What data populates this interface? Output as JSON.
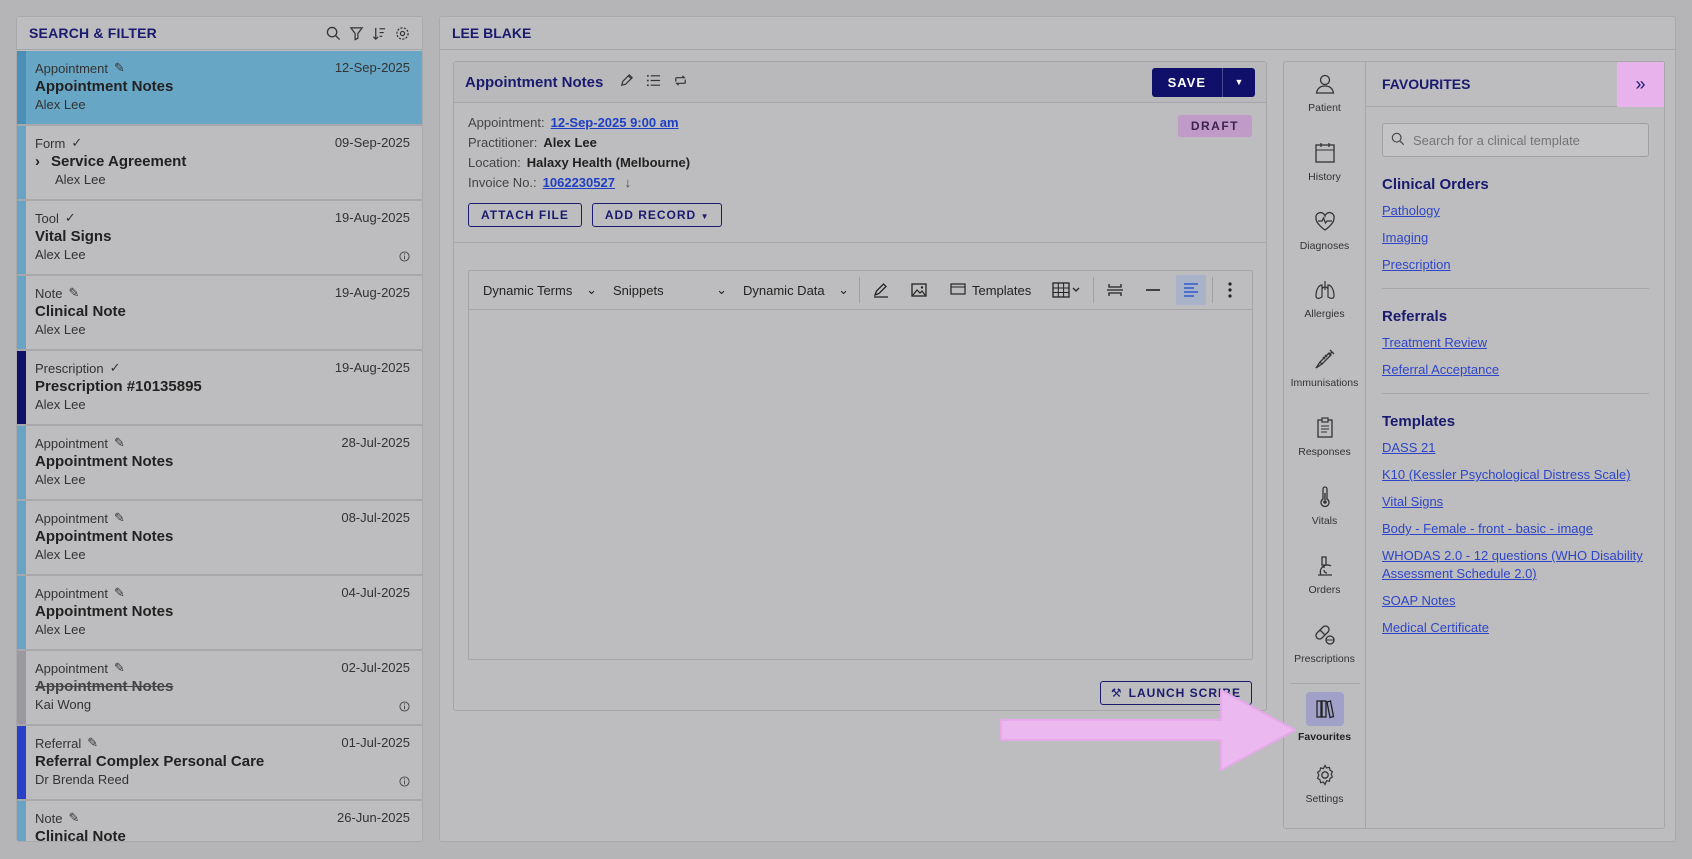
{
  "left_panel": {
    "title": "SEARCH & FILTER",
    "items": [
      {
        "type": "Appointment",
        "date": "12-Sep-2025",
        "title": "Appointment Notes",
        "who": "Alex Lee",
        "bar": "#6aa4c4"
      },
      {
        "type": "Form",
        "date": "09-Sep-2025",
        "title": "Service Agreement",
        "who": "Alex Lee",
        "bar": "#6aa4c4"
      },
      {
        "type": "Tool",
        "date": "19-Aug-2025",
        "title": "Vital Signs",
        "who": "Alex Lee",
        "bar": "#6aa4c4"
      },
      {
        "type": "Note",
        "date": "19-Aug-2025",
        "title": "Clinical Note",
        "who": "Alex Lee",
        "bar": "#6aa4c4"
      },
      {
        "type": "Prescription",
        "date": "19-Aug-2025",
        "title": "Prescription #10135895",
        "who": "Alex Lee",
        "bar": "#10106a"
      },
      {
        "type": "Appointment",
        "date": "28-Jul-2025",
        "title": "Appointment Notes",
        "who": "Alex Lee",
        "bar": "#6aa4c4"
      },
      {
        "type": "Appointment",
        "date": "08-Jul-2025",
        "title": "Appointment Notes",
        "who": "Alex Lee",
        "bar": "#6aa4c4"
      },
      {
        "type": "Appointment",
        "date": "04-Jul-2025",
        "title": "Appointment Notes",
        "who": "Alex Lee",
        "bar": "#6aa4c4"
      },
      {
        "type": "Appointment",
        "date": "02-Jul-2025",
        "title": "Appointment Notes",
        "who": "Kai Wong",
        "bar": "#9a9a9e"
      },
      {
        "type": "Referral",
        "date": "01-Jul-2025",
        "title": "Referral Complex Personal Care",
        "who": "Dr Brenda Reed",
        "bar": "#2a3fc8"
      },
      {
        "type": "Note",
        "date": "26-Jun-2025",
        "title": "Clinical Note",
        "who": "",
        "bar": "#6aa4c4"
      }
    ]
  },
  "main": {
    "patient_name": "LEE BLAKE",
    "note": {
      "title": "Appointment Notes",
      "save_label": "SAVE",
      "status_badge": "DRAFT",
      "appointment_label": "Appointment:",
      "appointment_value": "12-Sep-2025 9:00 am",
      "practitioner_label": "Practitioner:",
      "practitioner_value": "Alex Lee",
      "location_label": "Location:",
      "location_value": "Halaxy Health (Melbourne)",
      "invoice_label": "Invoice No.:",
      "invoice_value": "1062230527",
      "attach_file_label": "ATTACH FILE",
      "add_record_label": "ADD RECORD",
      "launch_scribe_label": "LAUNCH SCRIBE"
    },
    "toolbar": {
      "dynamic_terms": "Dynamic Terms",
      "snippets": "Snippets",
      "dynamic_data": "Dynamic Data",
      "templates": "Templates"
    }
  },
  "rail": {
    "items": [
      {
        "label": "Patient",
        "icon": "person-icon"
      },
      {
        "label": "History",
        "icon": "calendar-icon"
      },
      {
        "label": "Diagnoses",
        "icon": "heart-pulse-icon"
      },
      {
        "label": "Allergies",
        "icon": "lungs-icon"
      },
      {
        "label": "Immunisations",
        "icon": "syringe-icon"
      },
      {
        "label": "Responses",
        "icon": "clipboard-icon"
      },
      {
        "label": "Vitals",
        "icon": "thermometer-icon"
      },
      {
        "label": "Orders",
        "icon": "microscope-icon"
      },
      {
        "label": "Prescriptions",
        "icon": "pills-icon"
      },
      {
        "label": "Favourites",
        "icon": "books-icon"
      },
      {
        "label": "Settings",
        "icon": "gear-icon"
      }
    ]
  },
  "favourites": {
    "title": "FAVOURITES",
    "search_placeholder": "Search for a clinical template",
    "sections": [
      {
        "heading": "Clinical Orders",
        "links": [
          "Pathology",
          "Imaging",
          "Prescription"
        ]
      },
      {
        "heading": "Referrals",
        "links": [
          "Treatment Review",
          "Referral Acceptance"
        ]
      },
      {
        "heading": "Templates",
        "links": [
          "DASS 21",
          "K10 (Kessler Psychological Distress Scale)",
          "Vital Signs",
          "Body - Female - front - basic - image",
          "WHODAS 2.0 - 12 questions (WHO Disability Assessment Schedule 2.0)",
          "SOAP Notes",
          "Medical Certificate"
        ]
      }
    ]
  },
  "colors": {
    "navy": "#1a1a6e",
    "selected_row": "#68a6c6",
    "draft_badge": "#c09bc8",
    "collapse_button": "#e8b2ec",
    "arrow": "#ecb8f0",
    "link": "#2f45c8"
  }
}
